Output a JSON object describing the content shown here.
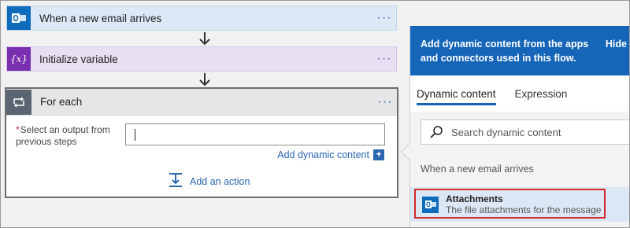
{
  "flow": {
    "steps": [
      {
        "label": "When a new email arrives",
        "icon": "outlook-icon",
        "more": "···"
      },
      {
        "label": "Initialize variable",
        "icon": "variable-icon",
        "icon_glyph": "{x}",
        "more": "···"
      }
    ],
    "foreach": {
      "label": "For each",
      "icon": "loop-icon",
      "more": "···",
      "field_required_mark": "*",
      "field_label": "Select an output from previous steps",
      "field_value": "",
      "add_dynamic_label": "Add dynamic content",
      "add_action_label": "Add an action"
    }
  },
  "panel": {
    "banner_text": "Add dynamic content from the apps and connectors used in this flow.",
    "hide_label": "Hide",
    "tabs": [
      {
        "label": "Dynamic content",
        "active": true
      },
      {
        "label": "Expression",
        "active": false
      }
    ],
    "search_placeholder": "Search dynamic content",
    "section_title": "When a new email arrives",
    "items": [
      {
        "title": "Attachments",
        "description": "The file attachments for the message",
        "icon": "outlook-icon",
        "highlighted": true
      }
    ]
  },
  "colors": {
    "accent_blue": "#1565b8",
    "email_step_bg": "#dce8f5",
    "variable_step_bg": "#e9dff2",
    "highlight_red": "#d22a2a"
  }
}
